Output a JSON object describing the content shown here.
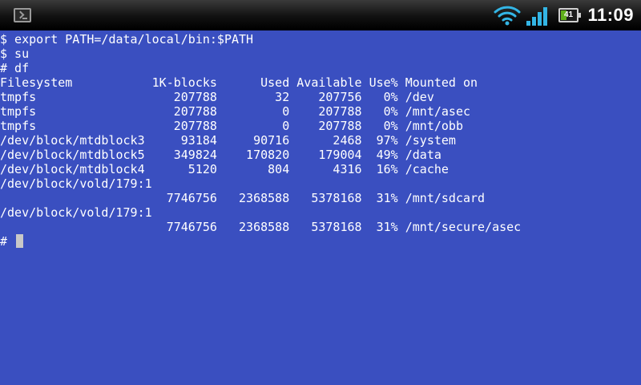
{
  "status_bar": {
    "clock": "11:09",
    "battery_level": "41",
    "battery_fill": 0.41,
    "app_icon": "terminal-icon",
    "wifi_icon": "wifi-icon",
    "signal_icon": "signal-icon"
  },
  "terminal": {
    "lines": [
      "$ export PATH=/data/local/bin:$PATH",
      "$ su",
      "# df",
      "Filesystem           1K-blocks      Used Available Use% Mounted on",
      "tmpfs                   207788        32    207756   0% /dev",
      "tmpfs                   207788         0    207788   0% /mnt/asec",
      "tmpfs                   207788         0    207788   0% /mnt/obb",
      "/dev/block/mtdblock3     93184     90716      2468  97% /system",
      "/dev/block/mtdblock5    349824    170820    179004  49% /data",
      "/dev/block/mtdblock4      5120       804      4316  16% /cache",
      "/dev/block/vold/179:1",
      "                       7746756   2368588   5378168  31% /mnt/sdcard",
      "/dev/block/vold/179:1",
      "                       7746756   2368588   5378168  31% /mnt/secure/asec"
    ],
    "prompt": "# "
  },
  "colors": {
    "terminal_background": "#3a4fc0",
    "terminal_text": "#ffffff",
    "statusbar_background": "#000000",
    "battery_green": "#5fae1a",
    "signal_blue": "#33b5e5"
  }
}
